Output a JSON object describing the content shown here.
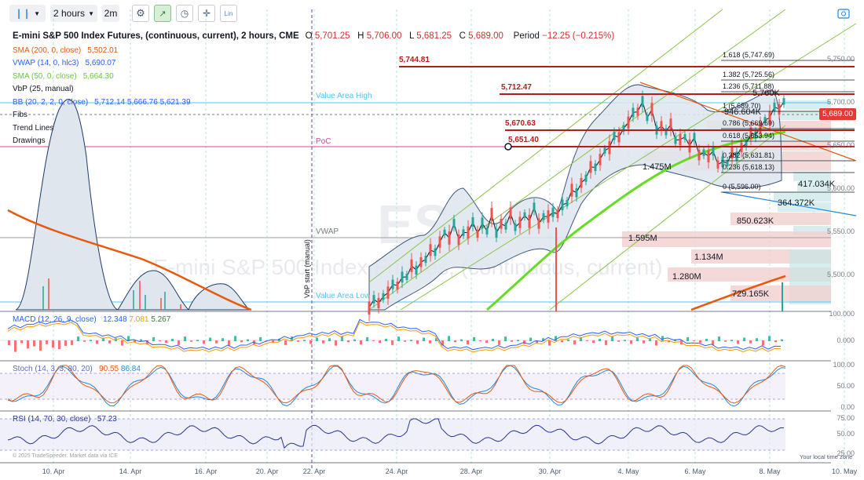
{
  "toolbar": {
    "interval": "2 hours",
    "interval2": "2m",
    "log_label": "Lin"
  },
  "header": {
    "title": "E-mini S&P 500 Index Futures, (continuous, current), 2 hours, CME",
    "open_label": "O",
    "open": "5,701.25",
    "high_label": "H",
    "high": "5,706.00",
    "low_label": "L",
    "low": "5,681.25",
    "close_label": "C",
    "close": "5,689.00",
    "period_label": "Period",
    "period": "−12.25 (−0.215%)"
  },
  "indicators": [
    {
      "label": "SMA (200, 0, close)",
      "value": "5,502.01",
      "color": "#e8590c"
    },
    {
      "label": "VWAP (14, 0, hlc3)",
      "value": "5,690.07",
      "color": "#2962ff"
    },
    {
      "label": "SMA (50, 0, close)",
      "value": "5,664.30",
      "color": "#66cc33"
    },
    {
      "label": "VbP (25, manual)",
      "value": "",
      "color": "#131722"
    },
    {
      "label": "BB (20, 2, 2, 0, close)",
      "value": "5,712.14   5,666.76   5,621.39",
      "color": "#2962ff"
    },
    {
      "label": "Fibs",
      "value": "",
      "color": "#131722"
    },
    {
      "label": "Trend Lines",
      "value": "",
      "color": "#131722"
    },
    {
      "label": "Drawings",
      "value": "",
      "color": "#131722"
    }
  ],
  "current_price": "5,689.00",
  "price_axis": [
    "5,750.00",
    "5,700.00",
    "5,650.00",
    "5,600.00",
    "5,550.00",
    "5,500.00"
  ],
  "x_axis": [
    "10. Apr",
    "14. Apr",
    "16. Apr",
    "20. Apr",
    "22. Apr",
    "24. Apr",
    "28. Apr",
    "30. Apr",
    "4. May",
    "6. May",
    "8. May",
    "10. May"
  ],
  "levels": {
    "l1": "5,744.81",
    "l2": "5,712.47",
    "l3": "5,670.63",
    "l4": "5,651.40",
    "vah": "Value Area High",
    "poc": "PoC",
    "vwap": "VWAP",
    "val": "Value Area Low",
    "vbp_start": "VbP start (manual)"
  },
  "fibs": [
    "1.618 (5,747.69)",
    "1.382 (5,725.56)",
    "1.236 (5,711.88)",
    "1 (5,689.70)",
    "0.786 (5,669.69)",
    "0.618 (5,653.94)",
    "0.382 (5,631.81)",
    "0.236 (5,618.13)",
    "0 (5,596.00)"
  ],
  "volume_labels": [
    "5.760K",
    "946.604K",
    "1.475M",
    "417.034K",
    "364.372K",
    "850.623K",
    "1.595M",
    "1.134M",
    "1.280M",
    "729.165K"
  ],
  "watermark": {
    "symbol": "ES",
    "name": "E-mini S&P 500 Index Futures, (continuous, current)"
  },
  "macd": {
    "label": "MACD (12, 26, 9, close)",
    "v1": "12.348",
    "v2": "7.081",
    "v3": "5.267",
    "axis": [
      "100.000",
      "0.000"
    ]
  },
  "stoch": {
    "label": "Stoch (14, 3, 3, 80, 20)",
    "v1": "90.55",
    "v2": "86.84",
    "axis": [
      "100.00",
      "50.00",
      "0.00"
    ]
  },
  "rsi": {
    "label": "RSI (14, 70, 30, close)",
    "v1": "57.23",
    "axis": [
      "75.00",
      "50.00",
      "25.00"
    ]
  },
  "footer": {
    "copyright": "© 2025 TradeSpeeder. Market data via ICE",
    "tz": "Your local time zone"
  }
}
